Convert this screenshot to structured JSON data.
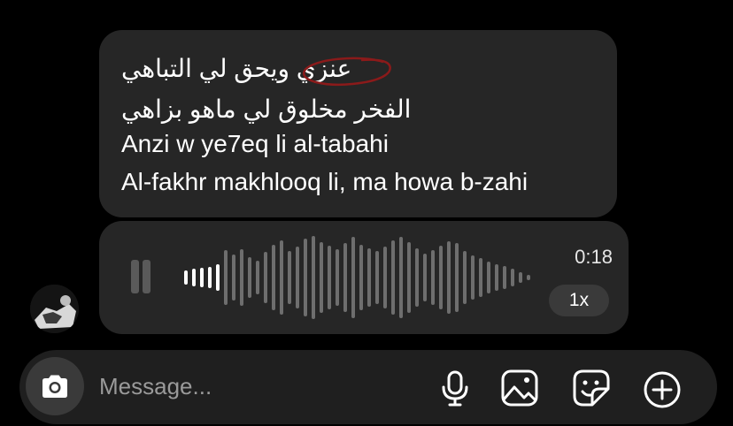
{
  "message": {
    "lines": [
      "عنزي ويحق لي التباهي",
      "الفخر مخلوق لي ماهو بزاهي",
      "Anzi w ye7eq li al-tabahi",
      "Al-fakhr makhlooq li, ma howa b-zahi"
    ]
  },
  "voice_message": {
    "duration": "0:18",
    "speed": "1x",
    "state_icon": "pause-icon"
  },
  "composer": {
    "placeholder": "Message...",
    "value": "",
    "icons": [
      "camera-icon",
      "microphone-icon",
      "gallery-icon",
      "sticker-icon",
      "plus-circle-icon"
    ]
  },
  "colors": {
    "background": "#000000",
    "bubble": "#262626",
    "composer": "#1f1f1f",
    "annotation_circle": "#8b1a1a"
  }
}
